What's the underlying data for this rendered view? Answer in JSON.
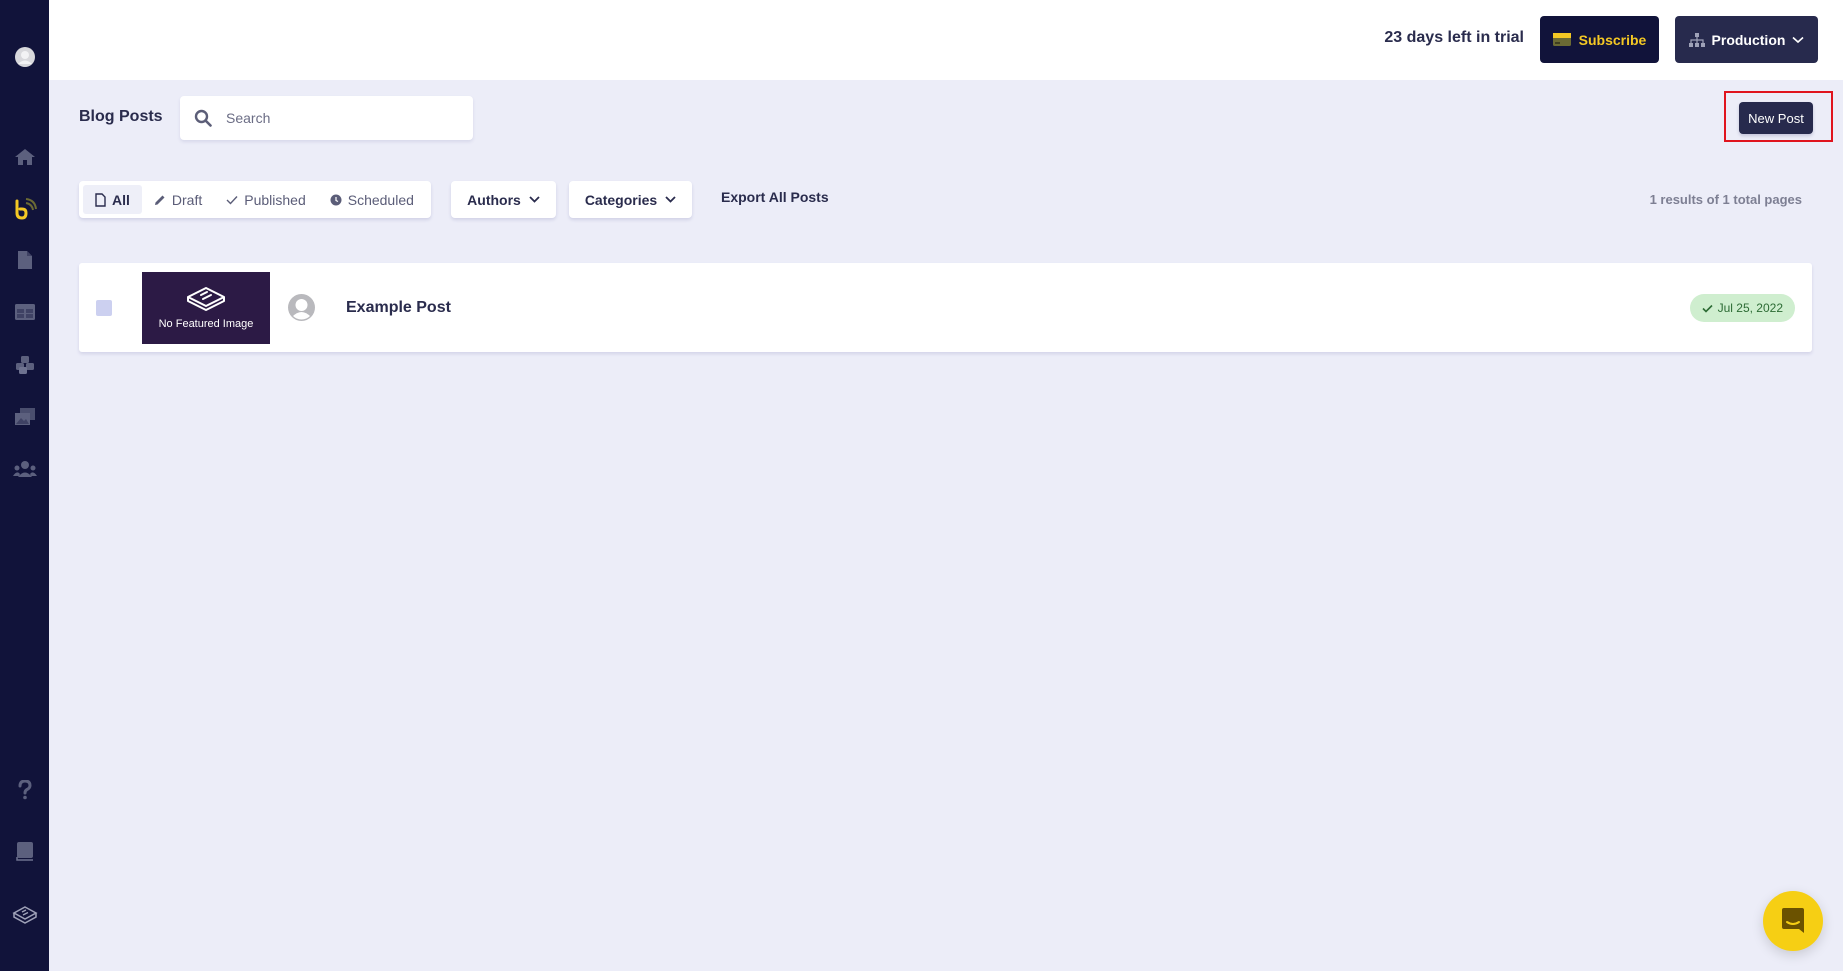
{
  "sidebar": {
    "items": [
      {
        "name": "profile-avatar-icon"
      },
      {
        "name": "home-icon"
      },
      {
        "name": "blog-icon",
        "active": true
      },
      {
        "name": "pages-icon"
      },
      {
        "name": "layouts-icon"
      },
      {
        "name": "modules-icon"
      },
      {
        "name": "media-icon"
      },
      {
        "name": "users-icon"
      },
      {
        "name": "help-icon"
      },
      {
        "name": "docs-icon"
      },
      {
        "name": "brand-logo-icon"
      }
    ]
  },
  "topbar": {
    "trial_text": "23 days left in trial",
    "subscribe_label": "Subscribe",
    "environment_label": "Production"
  },
  "page": {
    "title": "Blog Posts",
    "new_post_label": "New Post"
  },
  "search": {
    "placeholder": "Search",
    "value": ""
  },
  "filters": {
    "tabs": [
      {
        "label": "All",
        "icon": "file-icon",
        "active": true
      },
      {
        "label": "Draft",
        "icon": "pencil-icon",
        "active": false
      },
      {
        "label": "Published",
        "icon": "check-icon",
        "active": false
      },
      {
        "label": "Scheduled",
        "icon": "clock-icon",
        "active": false
      }
    ],
    "authors_label": "Authors",
    "categories_label": "Categories",
    "export_label": "Export All Posts",
    "results_text": "1 results of 1 total pages"
  },
  "posts": [
    {
      "featured_image_text": "No Featured Image",
      "title": "Example Post",
      "status": "published",
      "date": "Jul 25, 2022"
    }
  ],
  "colors": {
    "sidebar_bg": "#11133a",
    "accent_yellow": "#f4c824",
    "primary_button": "#272a4d",
    "page_bg": "#ecedf8",
    "highlight_red": "#e0141e",
    "badge_green_bg": "#cfeecf"
  }
}
